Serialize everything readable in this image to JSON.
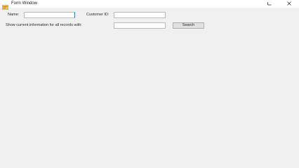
{
  "window": {
    "title": "Form Window",
    "minimize_glyph": "—",
    "close_glyph": "✕"
  },
  "form": {
    "name_label": "Name:",
    "name_value": "",
    "customer_label": "Customer ID:",
    "customer_value": "",
    "question_label": "Show current information for all records with:",
    "question_value": "",
    "search_button": "Search"
  },
  "icons": {
    "app": "form-app-icon",
    "minimize": "minimize-icon",
    "close": "close-icon"
  }
}
